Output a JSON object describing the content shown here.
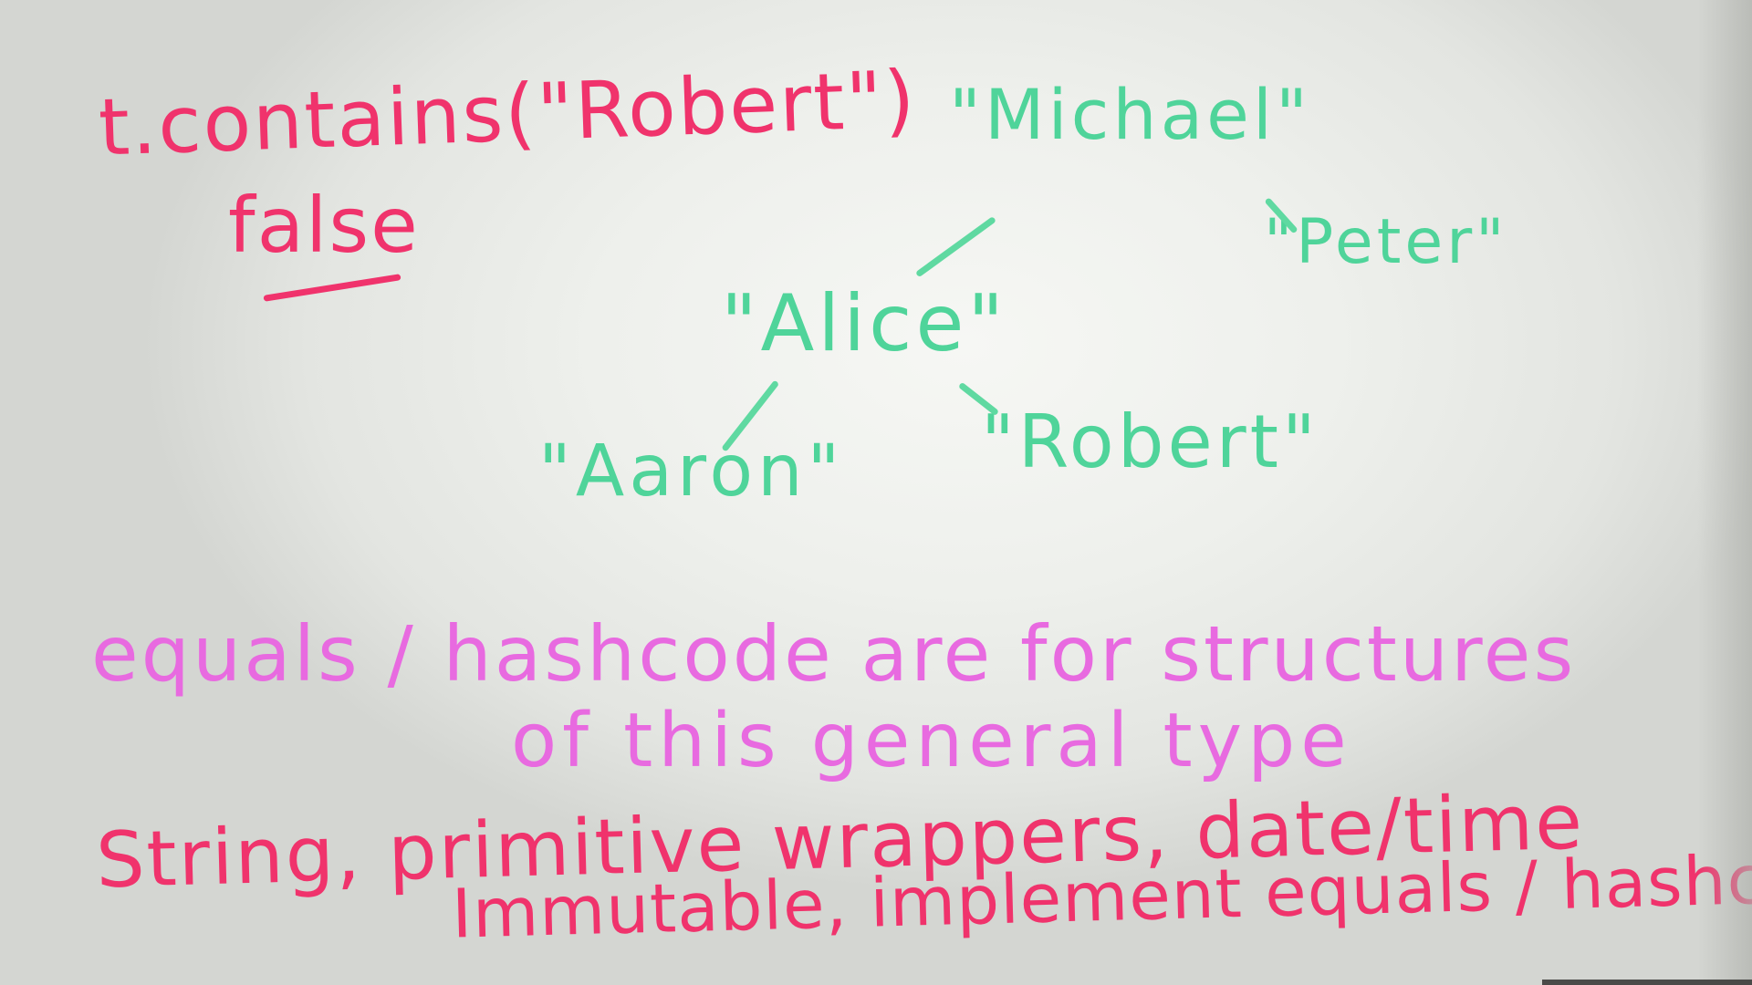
{
  "whiteboard": {
    "query": {
      "expression": "t.contains(\"Robert\")",
      "result": "false"
    },
    "tree": {
      "nodes": {
        "michael": "\"Michael\"",
        "peter": "\"Peter\"",
        "alice": "\"Alice\"",
        "aaron": "\"Aaron\"",
        "robert": "\"Robert\""
      },
      "edges": [
        {
          "from": "michael",
          "to": "alice"
        },
        {
          "from": "michael",
          "to": "peter"
        },
        {
          "from": "alice",
          "to": "aaron"
        },
        {
          "from": "alice",
          "to": "robert"
        }
      ]
    },
    "notes": {
      "line1": "equals / hashcode are for structures",
      "line2": "of this general type",
      "line3": "String, primitive wrappers, date/time",
      "line4": "Immutable, implement equals / hashcode"
    },
    "colors": {
      "query_ink": "#f0336c",
      "tree_ink": "#4fd49a",
      "notes_ink": "#e86ae0",
      "types_ink": "#f0336c",
      "board": "#eef0ec"
    }
  }
}
